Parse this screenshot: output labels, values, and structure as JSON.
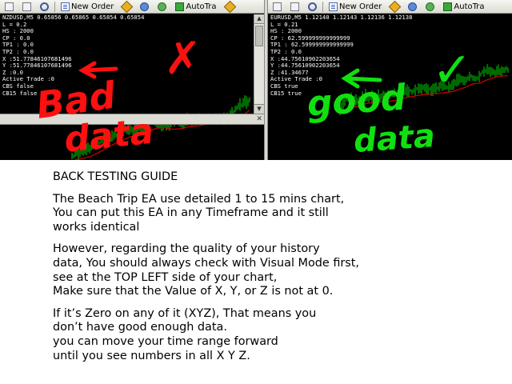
{
  "left_window": {
    "toolbar": {
      "new_order_label": "New Order",
      "autotrade_label": "AutoTra"
    },
    "info_lines": [
      "NZDUSD,M5  0.65856 0.65865 0.65854 0.65854",
      "L = 0.2",
      "HS : 2000",
      "CP : 0.0",
      "TP1 : 0.0",
      "TP2 : 0.0",
      "X :51.77846107681496",
      "Y :51.77846107681496",
      "Z :0.0",
      "Active Trade :0",
      "CBS false",
      "CB15 false"
    ],
    "annotation": [
      "✗",
      "Bad",
      "data"
    ],
    "annotation_color": "#ff0000"
  },
  "right_window": {
    "toolbar": {
      "new_order_label": "New Order",
      "autotrade_label": "AutoTra"
    },
    "info_lines": [
      "EURUSD,M5  1.12140 1.12143 1.12136 1.12138",
      "L = 0.21",
      "HS : 2000",
      "CP : 62.599999999999999",
      "TP1 : 62.599999999999999",
      "TP2 : 0.0",
      "X :44.75610902203654",
      "Y :44.75610902203654",
      "Z :41.34677",
      "Active Trade :0",
      "CBS true",
      "CB15 true"
    ],
    "annotation": [
      "✓",
      "good",
      "data"
    ],
    "annotation_color": "#00e000"
  },
  "chart_colors": {
    "candles": "#00d000",
    "ma": "#d00000",
    "background": "#000000",
    "info_text": "#ffffff"
  },
  "guide": {
    "title": "BACK TESTING GUIDE",
    "paragraphs": [
      [
        "The Beach Trip EA use detailed 1 to 15 mins chart,",
        "You can put this EA in any Timeframe and it still",
        "works identical"
      ],
      [
        "However, regarding the quality of your history",
        "data, You should always check with Visual Mode first,",
        "see at the TOP LEFT side of your chart,",
        "Make sure that the Value of X, Y, or Z is not at 0."
      ],
      [
        "If it’s Zero on any of it (XYZ), That means you",
        "don’t have good enough data.",
        "you can move your time range forward",
        "until you see numbers in all X Y Z."
      ]
    ]
  }
}
